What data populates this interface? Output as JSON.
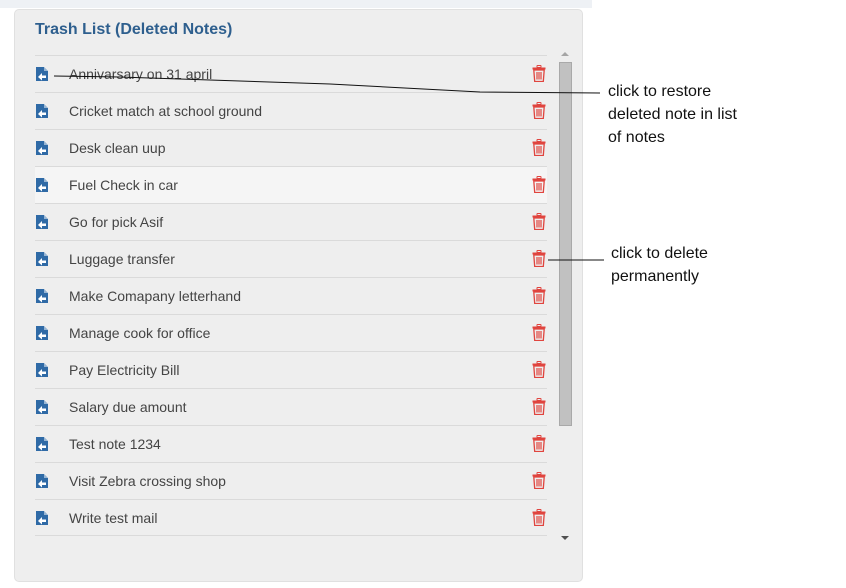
{
  "panel": {
    "title": "Trash List (Deleted Notes)"
  },
  "notes": [
    {
      "label": "Annivarsary on 31 april"
    },
    {
      "label": "Cricket match at school ground"
    },
    {
      "label": "Desk clean uup"
    },
    {
      "label": "Fuel Check in car"
    },
    {
      "label": "Go for pick Asif"
    },
    {
      "label": "Luggage transfer"
    },
    {
      "label": "Make Comapany letterhand"
    },
    {
      "label": "Manage cook for office"
    },
    {
      "label": "Pay Electricity Bill"
    },
    {
      "label": "Salary due amount"
    },
    {
      "label": "Test note 1234"
    },
    {
      "label": "Visit Zebra crossing shop"
    },
    {
      "label": "Write test mail"
    }
  ],
  "annotations": {
    "restore_line1": "click to restore",
    "restore_line2": "deleted note in list",
    "restore_line3": "of notes",
    "delete_line1": "click to delete",
    "delete_line2": "permanently"
  },
  "colors": {
    "title": "#2e5f8e",
    "restore_icon": "#2f6aa6",
    "delete_icon": "#e0443e"
  },
  "icons": {
    "restore": "restore-document-icon",
    "delete": "trash-icon"
  }
}
